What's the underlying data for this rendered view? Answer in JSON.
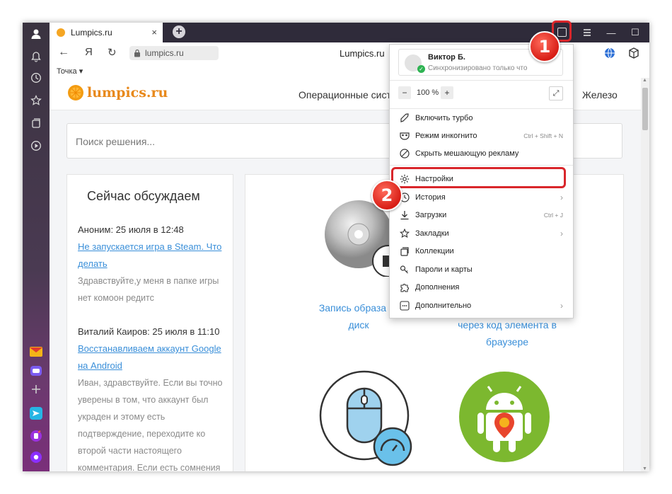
{
  "browser": {
    "tab_title": "Lumpics.ru",
    "tab_close": "×",
    "new_tab": "+",
    "win_minimize": "—",
    "win_maximize": "☐",
    "win_close": "✕",
    "address_url": "lumpics.ru",
    "page_title_center": "Lumpics.ru",
    "yandex_button": "Я",
    "bookmark": "Точка ▾"
  },
  "site": {
    "logo_text": "lumpics.ru",
    "nav_os": "Операционные сист",
    "nav_hardware": "Железо",
    "search_placeholder": "Поиск решения...",
    "discuss": {
      "title": "Сейчас обсуждаем",
      "items": [
        {
          "author": "Аноним: 25 июля в 12:48",
          "link_line1": "Не запускается игра в Steam. Что",
          "link_line2": "делать",
          "body_line1": "Здравствуйте,у меня в папке игры",
          "body_line2": "нет комоон редитс"
        },
        {
          "author": "Виталий Каиров: 25 июля в 11:10",
          "link_line1": "Восстанавливаем аккаунт Google",
          "link_line2": "на Android",
          "body_lines": [
            "Иван, здравствуйте. Если вы точно",
            "уверены в том, что аккаунт был",
            "украден и этому есть",
            "подтверждение, переходите ко",
            "второй части настоящего",
            "комментария. Если есть сомнения"
          ]
        }
      ]
    },
    "articles": {
      "a1_line1": "Запись образа IS",
      "a1_line2": "диск",
      "a2_line1": "через код элемента в",
      "a2_line2": "браузере"
    }
  },
  "menu": {
    "profile_name": "Виктор Б.",
    "profile_sync": "Синхронизировано только что",
    "zoom_minus": "−",
    "zoom_value": "100 %",
    "zoom_plus": "+",
    "items": [
      {
        "label": "Включить турбо",
        "shortcut": ""
      },
      {
        "label": "Режим инкогнито",
        "shortcut": "Ctrl + Shift + N"
      },
      {
        "label": "Скрыть мешающую рекламу",
        "shortcut": ""
      },
      {
        "label": "Настройки",
        "shortcut": ""
      },
      {
        "label": "История",
        "shortcut": ""
      },
      {
        "label": "Загрузки",
        "shortcut": "Ctrl + J"
      },
      {
        "label": "Закладки",
        "shortcut": ""
      },
      {
        "label": "Коллекции",
        "shortcut": ""
      },
      {
        "label": "Пароли и карты",
        "shortcut": ""
      },
      {
        "label": "Дополнения",
        "shortcut": ""
      },
      {
        "label": "Дополнительно",
        "shortcut": ""
      }
    ],
    "arrow": "›"
  },
  "annotations": {
    "badge1": "1",
    "badge2": "2",
    "highlight_color": "#d9262b"
  }
}
